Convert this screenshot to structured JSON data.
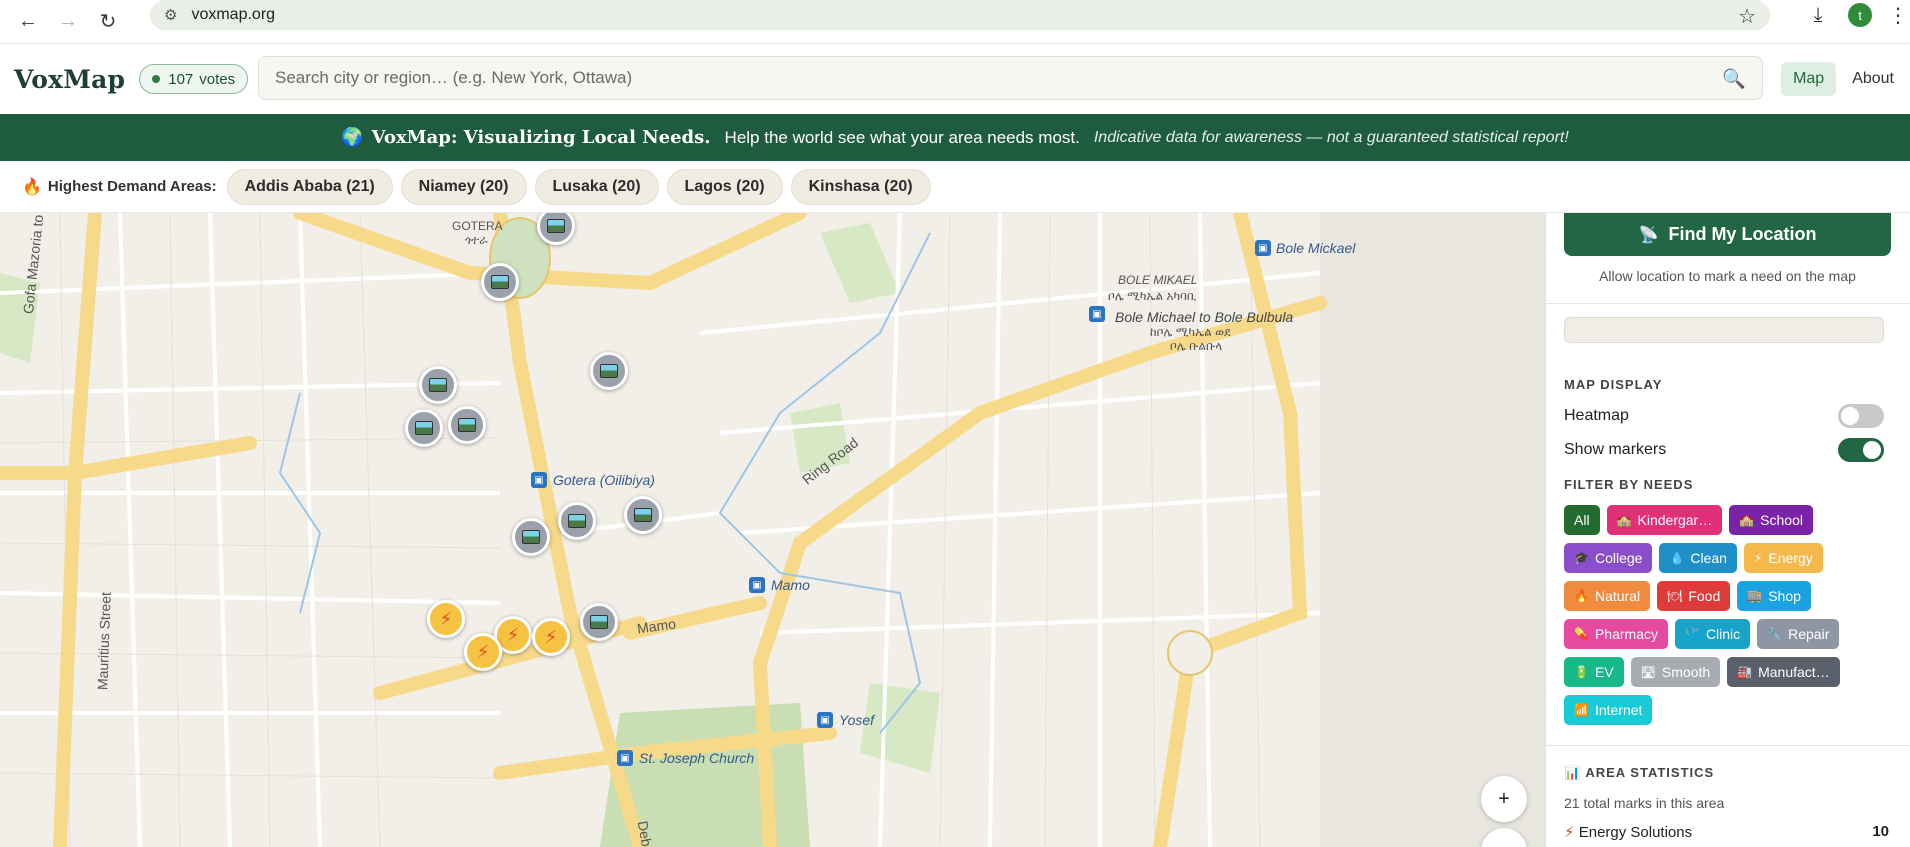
{
  "browser": {
    "url": "voxmap.org",
    "profile_initial": "t"
  },
  "header": {
    "logo": "VoxMap",
    "votes_count": "107",
    "votes_label": "votes",
    "search_placeholder": "Search city or region… (e.g. New York, Ottawa)",
    "nav": [
      {
        "label": "Map",
        "active": true
      },
      {
        "label": "About",
        "active": false
      }
    ]
  },
  "banner": {
    "title": "VoxMap: Visualizing Local Needs.",
    "subtitle": "Help the world see what your area needs most.",
    "note": "Indicative data for awareness — not a guaranteed statistical report!"
  },
  "demand": {
    "label": "Highest Demand Areas:",
    "areas": [
      "Addis Ababa (21)",
      "Niamey (20)",
      "Lusaka (20)",
      "Lagos (20)",
      "Kinshasa (20)"
    ]
  },
  "map": {
    "labels": {
      "gotera": "GOTERA",
      "gotera_am": "ጎተራ",
      "bole_mikael": "BOLE MIKAEL",
      "bole_mikael_am": "ቦሌ ሚካኤል አካባቢ",
      "bole_bulbula": "Bole Michael to Bole Bulbula",
      "bole_bulbula_am1": "ከቦሌ ሚካኤል ወደ",
      "bole_bulbula_am2": "ቦሌ ቡልቡላ",
      "stop_bole_mikael": "Bole Mickael",
      "stop_gotera": "Gotera (Oilibiya)",
      "stop_mamo": "Mamo",
      "road_mamo": "Mamo",
      "stop_yosef": "Yosef",
      "stop_st_joseph": "St. Joseph Church",
      "ring_road": "Ring Road",
      "gofa": "Gofa Mazoria to Mebrat",
      "mauritius": "Mauritius Street",
      "debre": "Debr"
    },
    "zoom_in": "+"
  },
  "panel": {
    "find_label": "Find My Location",
    "allow_text": "Allow location to mark a need on the map",
    "map_display_title": "MAP DISPLAY",
    "heatmap_label": "Heatmap",
    "heatmap_on": false,
    "markers_label": "Show markers",
    "markers_on": true,
    "filter_title": "FILTER BY NEEDS",
    "filters": [
      {
        "label": "All",
        "icon": "",
        "color": "#236b2e"
      },
      {
        "label": "Kindergar…",
        "icon": "🏫",
        "color": "#e0307a"
      },
      {
        "label": "School",
        "icon": "🏫",
        "color": "#7a22a8"
      },
      {
        "label": "College",
        "icon": "🎓",
        "color": "#8a4ecb"
      },
      {
        "label": "Clean",
        "icon": "💧",
        "color": "#1f8fc7"
      },
      {
        "label": "Energy",
        "icon": "⚡",
        "color": "#f4b94a"
      },
      {
        "label": "Natural",
        "icon": "🔥",
        "color": "#f08a3e"
      },
      {
        "label": "Food",
        "icon": "🍽",
        "color": "#e03b3b"
      },
      {
        "label": "Shop",
        "icon": "🏬",
        "color": "#1aa3e0"
      },
      {
        "label": "Pharmacy",
        "icon": "💊",
        "color": "#e54aa0"
      },
      {
        "label": "Clinic",
        "icon": "🩺",
        "color": "#18a3c9"
      },
      {
        "label": "Repair",
        "icon": "🔧",
        "color": "#8e96a6"
      },
      {
        "label": "EV",
        "icon": "🔋",
        "color": "#17b88a"
      },
      {
        "label": "Smooth",
        "icon": "🛣",
        "color": "#a7acb3"
      },
      {
        "label": "Manufact…",
        "icon": "🏭",
        "color": "#59606b"
      },
      {
        "label": "Internet",
        "icon": "📶",
        "color": "#19cbd6"
      }
    ],
    "stats_title": "AREA STATISTICS",
    "stats_total": "21 total marks in this area",
    "stats_rows": [
      {
        "label": "Energy Solutions",
        "value": "10"
      }
    ]
  }
}
